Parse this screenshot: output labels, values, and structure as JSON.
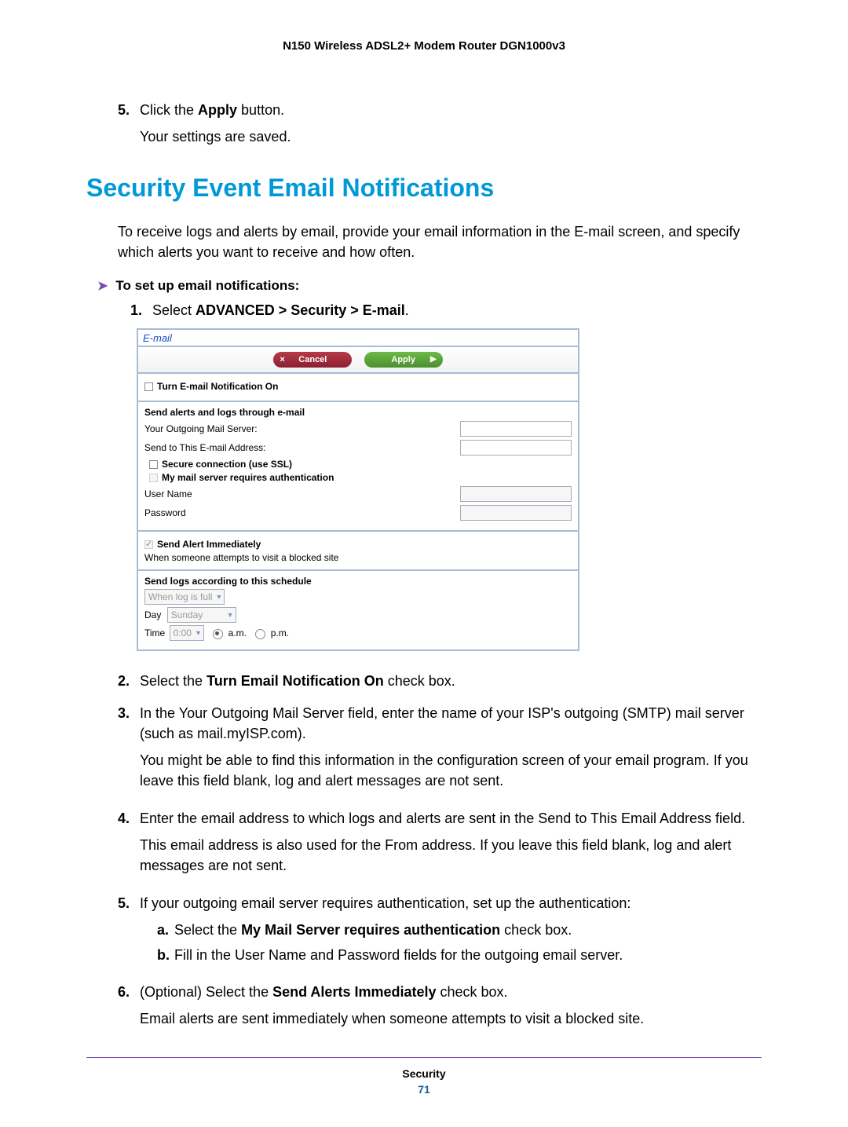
{
  "header": {
    "product_title": "N150 Wireless ADSL2+ Modem Router DGN1000v3"
  },
  "topsteps": {
    "n5": "5.",
    "s5_a": "Click the ",
    "s5_b": "Apply",
    "s5_c": " button.",
    "s5_line2": "Your settings are saved."
  },
  "section_title": "Security Event Email Notifications",
  "intro": "To receive logs and alerts by email, provide your email information in the E-mail screen, and specify which alerts you want to receive and how often.",
  "to_set": "To set up email notifications:",
  "step1": {
    "n": "1.",
    "a": "Select ",
    "b": "ADVANCED > Security > E-mail",
    "c": "."
  },
  "ui": {
    "panel_title": "E-mail",
    "cancel": "Cancel",
    "apply": "Apply",
    "turn_on": "Turn E-mail Notification On",
    "send_through": "Send alerts and logs through e-mail",
    "out_server": "Your Outgoing Mail Server:",
    "send_to": "Send to This E-mail Address:",
    "ssl": "Secure connection (use SSL)",
    "auth": "My mail server requires authentication",
    "user": "User Name",
    "pass": "Password",
    "alert_imm": "Send Alert Immediately",
    "alert_sub": "When someone attempts to visit a blocked site",
    "sched": "Send logs according to this schedule",
    "sched_sel": "When log is full",
    "day_label": "Day",
    "day_val": "Sunday",
    "time_label": "Time",
    "time_val": "0:00",
    "am": "a.m.",
    "pm": "p.m."
  },
  "steps": {
    "n2": "2.",
    "s2a": "Select the ",
    "s2b": "Turn Email Notification On",
    "s2c": " check box.",
    "n3": "3.",
    "s3": "In the Your Outgoing Mail Server field, enter the name of your ISP's outgoing (SMTP) mail server (such as mail.myISP.com).",
    "s3p": "You might be able to find this information in the configuration screen of your email program. If you leave this field blank, log and alert messages are not sent.",
    "n4": "4.",
    "s4": "Enter the email address to which logs and alerts are sent in the Send to This Email Address field.",
    "s4p": "This email address is also used for the From address. If you leave this field blank, log and alert messages are not sent.",
    "n5": "5.",
    "s5": "If your outgoing email server requires authentication, set up the authentication:",
    "na": "a.",
    "s5a_a": "Select the ",
    "s5a_b": "My Mail Server requires authentication",
    "s5a_c": " check box.",
    "nb": "b.",
    "s5b": "Fill in the User Name and Password fields for the outgoing email server.",
    "n6": "6.",
    "s6a": "(Optional) Select the ",
    "s6b": "Send Alerts Immediately",
    "s6c": " check box.",
    "s6p": "Email alerts are sent immediately when someone attempts to visit a blocked site."
  },
  "footer": {
    "section": "Security",
    "page": "71"
  }
}
